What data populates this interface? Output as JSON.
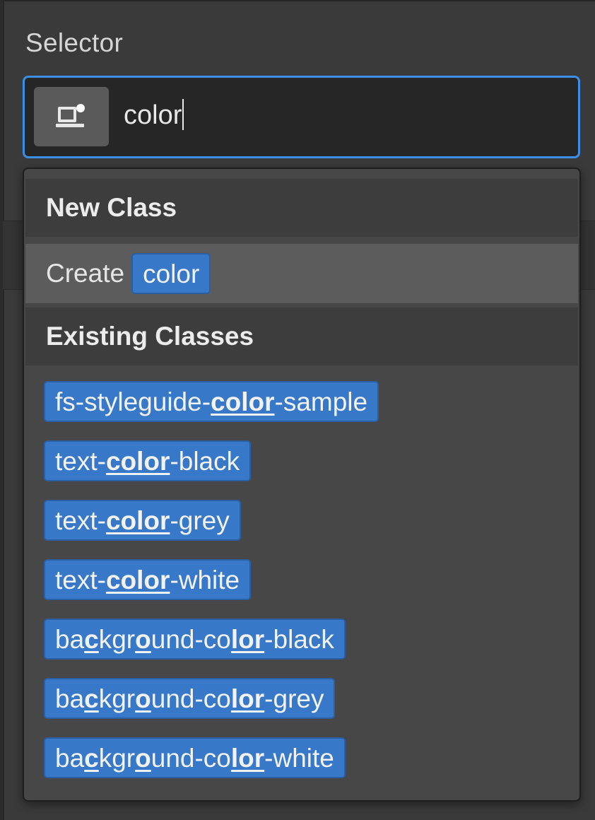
{
  "selector": {
    "label": "Selector",
    "query": "color",
    "state_icon": "device-state-icon"
  },
  "dropdown": {
    "new_class_header": "New Class",
    "create_label": "Create",
    "create_value": "color",
    "existing_header": "Existing Classes",
    "classes": [
      {
        "segments": [
          {
            "t": "fs-styleguide-",
            "m": false
          },
          {
            "t": "color",
            "m": true
          },
          {
            "t": "-sample",
            "m": false
          }
        ]
      },
      {
        "segments": [
          {
            "t": "text-",
            "m": false
          },
          {
            "t": "color",
            "m": true
          },
          {
            "t": "-black",
            "m": false
          }
        ]
      },
      {
        "segments": [
          {
            "t": "text-",
            "m": false
          },
          {
            "t": "color",
            "m": true
          },
          {
            "t": "-grey",
            "m": false
          }
        ]
      },
      {
        "segments": [
          {
            "t": "text-",
            "m": false
          },
          {
            "t": "color",
            "m": true
          },
          {
            "t": "-white",
            "m": false
          }
        ]
      },
      {
        "segments": [
          {
            "t": "ba",
            "m": false
          },
          {
            "t": "c",
            "m": true
          },
          {
            "t": "kgr",
            "m": false
          },
          {
            "t": "o",
            "m": true
          },
          {
            "t": "und-co",
            "m": false
          },
          {
            "t": "lor",
            "m": true
          },
          {
            "t": "-black",
            "m": false
          }
        ]
      },
      {
        "segments": [
          {
            "t": "ba",
            "m": false
          },
          {
            "t": "c",
            "m": true
          },
          {
            "t": "kgr",
            "m": false
          },
          {
            "t": "o",
            "m": true
          },
          {
            "t": "und-co",
            "m": false
          },
          {
            "t": "lor",
            "m": true
          },
          {
            "t": "-grey",
            "m": false
          }
        ]
      },
      {
        "segments": [
          {
            "t": "ba",
            "m": false
          },
          {
            "t": "c",
            "m": true
          },
          {
            "t": "kgr",
            "m": false
          },
          {
            "t": "o",
            "m": true
          },
          {
            "t": "und-co",
            "m": false
          },
          {
            "t": "lor",
            "m": true
          },
          {
            "t": "-white",
            "m": false
          }
        ]
      }
    ]
  },
  "colors": {
    "accent": "#3b8fe6",
    "pill": "#3778c9"
  }
}
